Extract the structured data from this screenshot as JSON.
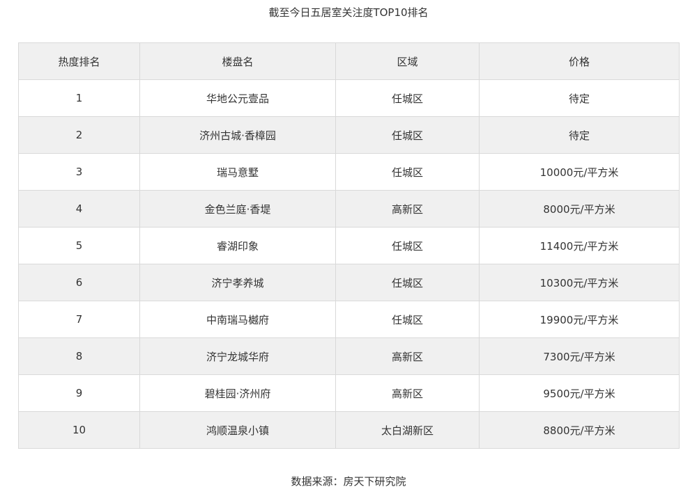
{
  "title": "截至今日五居室关注度TOP10排名",
  "table": {
    "headers": [
      "热度排名",
      "楼盘名",
      "区域",
      "价格"
    ],
    "rows": [
      {
        "rank": "1",
        "name": "华地公元壹品",
        "district": "任城区",
        "price": "待定"
      },
      {
        "rank": "2",
        "name": "济州古城·香樟园",
        "district": "任城区",
        "price": "待定"
      },
      {
        "rank": "3",
        "name": "瑞马意墅",
        "district": "任城区",
        "price": "10000元/平方米"
      },
      {
        "rank": "4",
        "name": "金色兰庭·香堤",
        "district": "高新区",
        "price": "8000元/平方米"
      },
      {
        "rank": "5",
        "name": "睿湖印象",
        "district": "任城区",
        "price": "11400元/平方米"
      },
      {
        "rank": "6",
        "name": "济宁孝养城",
        "district": "任城区",
        "price": "10300元/平方米"
      },
      {
        "rank": "7",
        "name": "中南瑞马樾府",
        "district": "任城区",
        "price": "19900元/平方米"
      },
      {
        "rank": "8",
        "name": "济宁龙城华府",
        "district": "高新区",
        "price": "7300元/平方米"
      },
      {
        "rank": "9",
        "name": "碧桂园·济州府",
        "district": "高新区",
        "price": "9500元/平方米"
      },
      {
        "rank": "10",
        "name": "鸿顺温泉小镇",
        "district": "太白湖新区",
        "price": "8800元/平方米"
      }
    ]
  },
  "source": "数据来源：房天下研究院"
}
